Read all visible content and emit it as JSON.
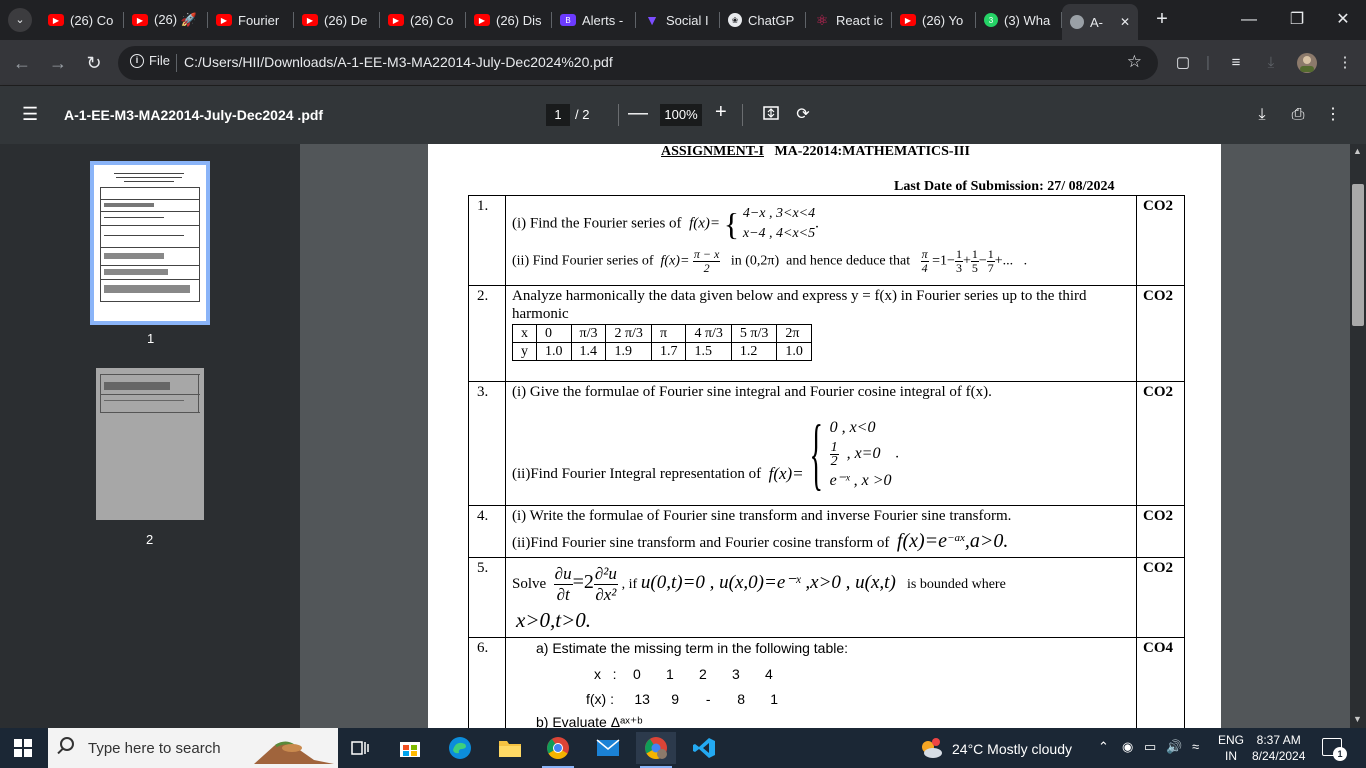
{
  "browser": {
    "tabs": [
      {
        "label": "(26) Co",
        "icon": "youtube-icon",
        "color": "#ff0000"
      },
      {
        "label": "(26) 🚀",
        "icon": "youtube-icon",
        "color": "#ff0000"
      },
      {
        "label": "Fourier",
        "icon": "youtube-icon",
        "color": "#ff0000"
      },
      {
        "label": "(26) De",
        "icon": "youtube-icon",
        "color": "#ff0000"
      },
      {
        "label": "(26) Co",
        "icon": "youtube-icon",
        "color": "#ff0000"
      },
      {
        "label": "(26) Dis",
        "icon": "youtube-icon",
        "color": "#ff0000"
      },
      {
        "label": "Alerts -",
        "icon": "b-icon",
        "color": "#6c3bff"
      },
      {
        "label": "Social I",
        "icon": "vee-icon",
        "color": "#7c4dff"
      },
      {
        "label": "ChatGP",
        "icon": "chatgpt-icon",
        "color": "#e8eaed"
      },
      {
        "label": "React ic",
        "icon": "react-icon",
        "color": "#e0245e"
      },
      {
        "label": "(26) Yo",
        "icon": "youtube-icon",
        "color": "#ff0000"
      },
      {
        "label": "(3) Wha",
        "icon": "whatsapp-icon",
        "color": "#25d366"
      },
      {
        "label": "A-",
        "icon": "globe-icon",
        "color": "#9aa0a6"
      }
    ],
    "active_tab_close": "✕",
    "url": "C:/Users/HII/Downloads/A-1-EE-M3-MA22014-July-Dec2024%20.pdf",
    "file_label": "File",
    "accent": "#8ab4f8"
  },
  "pdf": {
    "title": "A-1-EE-M3-MA22014-July-Dec2024 .pdf",
    "current_page": "1",
    "total_pages": "/  2",
    "zoom": "100%",
    "thumb_labels": [
      "1",
      "2"
    ]
  },
  "doc": {
    "heading_underlined": "ASSIGNMENT-I",
    "heading_rest": "MA-22014:MATHEMATICS-III",
    "last_date": "Last Date of Submission: 27/ 08/2024",
    "questions": [
      {
        "num": "1.",
        "co": "CO2",
        "part1_text": "(i) Find the Fourier series of",
        "part1_fx": "f(x)=",
        "part1_case1": "4−x , 3<x<4",
        "part1_case2": "x−4 , 4<x<5",
        "part2_text": "(ii) Find Fourier series of",
        "part2_fx": "f(x)=",
        "part2_num": "π − x",
        "part2_den": "2",
        "part2_range": "in (0,2π)",
        "part2_deduce": "and hence deduce that",
        "series_lhs_num": "π",
        "series_lhs_den": "4",
        "series_mid": "=1−",
        "series_terms": [
          "1/3",
          "1/5",
          "1/7"
        ],
        "series_ops": [
          "+",
          "−",
          "+..."
        ],
        "series_end": "."
      },
      {
        "num": "2.",
        "co": "CO2",
        "text": "Analyze harmonically the data given below and express y = f(x) in Fourier series up to the third harmonic",
        "row_x": [
          "x",
          "0",
          "π/3",
          "2 π/3",
          "π",
          "4 π/3",
          "5 π/3",
          "2π"
        ],
        "row_y": [
          "y",
          "1.0",
          "1.4",
          "1.9",
          "1.7",
          "1.5",
          "1.2",
          "1.0"
        ]
      },
      {
        "num": "3.",
        "co": "CO2",
        "part1_text": "(i) Give the formulae of Fourier sine integral and Fourier cosine integral of f(x).",
        "part2_text": "(ii)Find Fourier Integral representation of",
        "part2_fx": "f(x)=",
        "case1": "0   ,  x<0",
        "case2_num": "1",
        "case2_den": "2",
        "case2_rest": ",  x=0",
        "case3": "e⁻ˣ , x >0",
        "end": "."
      },
      {
        "num": "4.",
        "co": "CO2",
        "part1_text": "(i) Write the formulae of Fourier sine transform and inverse Fourier sine transform.",
        "part2_text": "(ii)Find Fourier sine transform and Fourier cosine transform of",
        "part2_math": "f(x)=e",
        "part2_exp": "−ax",
        "part2_tail": ",a>0."
      },
      {
        "num": "5.",
        "co": "CO2",
        "solve": "Solve",
        "lhs_num": "∂u",
        "lhs_den": "∂t",
        "eq": "=2",
        "rhs_num": "∂²u",
        "rhs_den": "∂x²",
        "condition": ", if",
        "cond_math": "u(0,t)=0 , u(x,0)=e⁻ˣ ,x>0 , u(x,t)",
        "bounded": "is bounded where",
        "line2": "x>0,t>0."
      },
      {
        "num": "6.",
        "co": "CO4",
        "part_a": "a)  Estimate the missing term in the following table:",
        "x_label": "x",
        "x_sep": ":",
        "x_values": [
          "0",
          "1",
          "2",
          "3",
          "4"
        ],
        "f_label": "f(x) :",
        "f_values": [
          "13",
          "9",
          "-",
          "8",
          "1"
        ],
        "part_b_peek": "b)  Evaluate  Δᵃˣ⁺ᵇ"
      }
    ]
  },
  "taskbar": {
    "search_placeholder": "Type here to search",
    "weather": "24°C  Mostly cloudy",
    "lang_top": "ENG",
    "lang_bottom": "IN",
    "time": "8:37 AM",
    "date": "8/24/2024",
    "notification_count": "1"
  }
}
